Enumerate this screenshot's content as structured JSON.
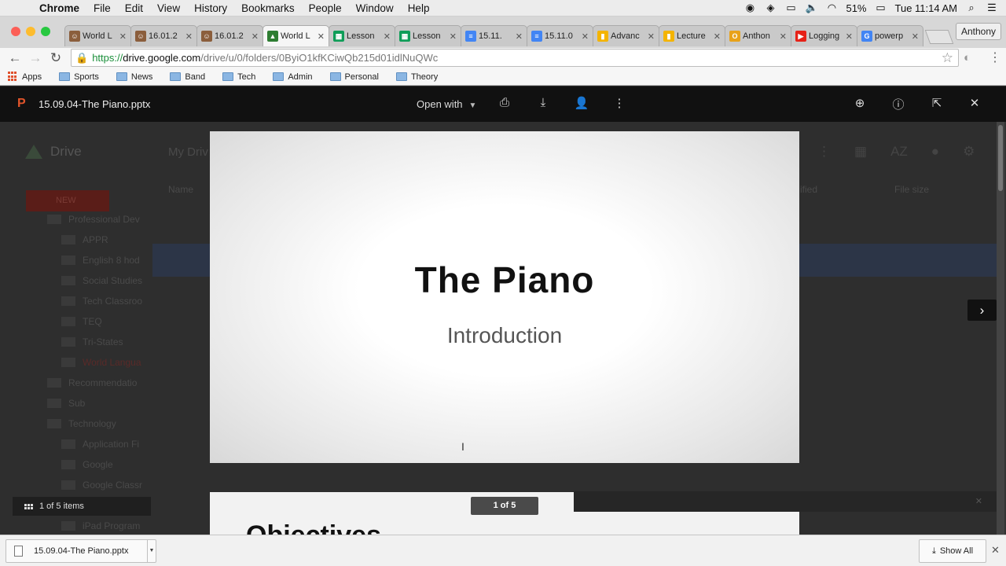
{
  "menubar": {
    "app": "Chrome",
    "items": [
      "File",
      "Edit",
      "View",
      "History",
      "Bookmarks",
      "People",
      "Window",
      "Help"
    ],
    "battery": "51%",
    "clock": "Tue 11:14 AM"
  },
  "tabs": [
    {
      "label": "World L",
      "icon": "person-icon",
      "color": "#8b5e3c",
      "active": false
    },
    {
      "label": "16.01.2",
      "icon": "person-icon",
      "color": "#8b5e3c",
      "active": false
    },
    {
      "label": "16.01.2",
      "icon": "person-icon",
      "color": "#8b5e3c",
      "active": false
    },
    {
      "label": "World L",
      "icon": "drive-icon",
      "color": "#2e7d32",
      "active": true
    },
    {
      "label": "Lesson",
      "icon": "sheets-icon",
      "color": "#0f9d58",
      "active": false
    },
    {
      "label": "Lesson",
      "icon": "sheets-icon",
      "color": "#0f9d58",
      "active": false
    },
    {
      "label": "15.11.",
      "icon": "docs-icon",
      "color": "#4285f4",
      "active": false
    },
    {
      "label": "15.11.0",
      "icon": "docs-icon",
      "color": "#4285f4",
      "active": false
    },
    {
      "label": "Advanc",
      "icon": "slides-icon",
      "color": "#f4b400",
      "active": false
    },
    {
      "label": "Lecture",
      "icon": "slides-icon",
      "color": "#f4b400",
      "active": false
    },
    {
      "label": "Anthon",
      "icon": "mail-icon",
      "color": "#e8a21a",
      "active": false
    },
    {
      "label": "Logging",
      "icon": "youtube-icon",
      "color": "#e62117",
      "active": false
    },
    {
      "label": "powerp",
      "icon": "google-icon",
      "color": "#4285f4",
      "active": false
    }
  ],
  "profile": "Anthony",
  "address": {
    "scheme": "https://",
    "host": "drive.google.com",
    "path": "/drive/u/0/folders/0ByiO1kfKCiwQb215d01idlNuQWc"
  },
  "bookmarks": [
    "Apps",
    "Sports",
    "News",
    "Band",
    "Tech",
    "Admin",
    "Personal",
    "Theory"
  ],
  "drive_background": {
    "title": "Drive",
    "crumb": "My Driv",
    "new_label": "NEW",
    "col_name": "Name",
    "col_modified": "ified",
    "col_size": "File size",
    "tree": [
      "Professional Dev",
      "APPR",
      "English 8 hod",
      "Social Studies",
      "Tech Classroo",
      "TEQ",
      "Tri-States",
      "World Langua",
      "Recommendatio",
      "Sub",
      "Technology",
      "Application Fi",
      "Google",
      "Google Classr",
      "iPhone",
      "iPad Program"
    ]
  },
  "viewer": {
    "file_name": "15.09.04-The Piano.pptx",
    "open_with": "Open with",
    "slide_title": "The Piano",
    "slide_subtitle": "Introduction",
    "next_slide_title": "Objectives",
    "item_counter": "1 of 5 items",
    "page_badge": "1 of 5"
  },
  "shelf": {
    "download_name": "15.09.04-The Piano.pptx",
    "show_all": "Show All"
  }
}
